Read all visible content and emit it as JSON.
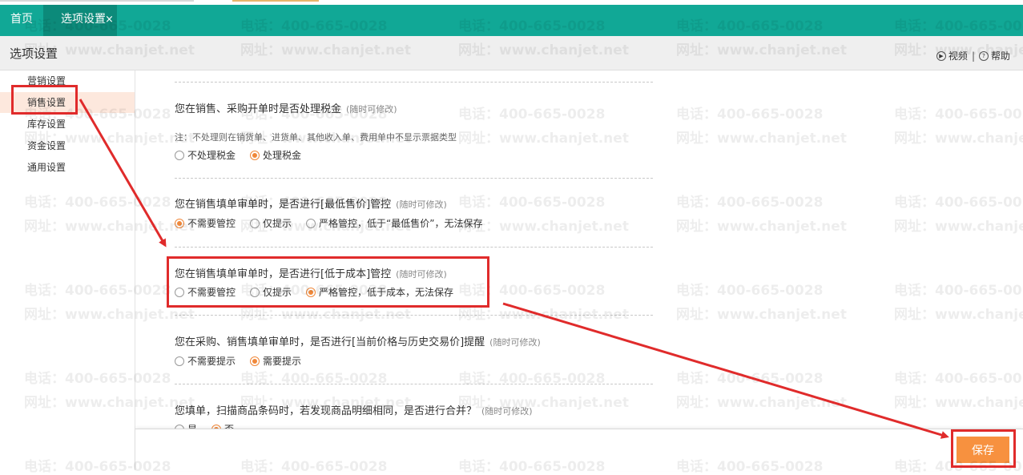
{
  "tabs": {
    "home": "首页",
    "active": "选项设置",
    "close": "×"
  },
  "header": {
    "title": "选项设置",
    "video": "视频",
    "help": "帮助",
    "divider": "|"
  },
  "sidebar": {
    "items": [
      {
        "label": "营销设置"
      },
      {
        "label": "销售设置",
        "active": true
      },
      {
        "label": "库存设置"
      },
      {
        "label": "资金设置"
      },
      {
        "label": "通用设置"
      }
    ]
  },
  "settings": [
    {
      "question": "您在销售、采购开单时是否处理税金",
      "hint": "(随时可修改)",
      "note": "注：不处理则在销货单、进货单、其他收入单、费用单中不显示票据类型",
      "options": [
        "不处理税金",
        "处理税金"
      ],
      "selected": 1
    },
    {
      "question": "您在销售填单审单时，是否进行[最低售价]管控",
      "hint": "(随时可修改)",
      "options": [
        "不需要管控",
        "仅提示",
        "严格管控，低于“最低售价”，无法保存"
      ],
      "selected": 0
    },
    {
      "question": "您在销售填单审单时，是否进行[低于成本]管控",
      "hint": "(随时可修改)",
      "options": [
        "不需要管控",
        "仅提示",
        "严格管控，低于成本，无法保存"
      ],
      "selected": 2
    },
    {
      "question": "您在采购、销售填单审单时，是否进行[当前价格与历史交易价]提醒",
      "hint": "(随时可修改)",
      "options": [
        "不需要提示",
        "需要提示"
      ],
      "selected": 1
    },
    {
      "question": "您填单，扫描商品条码时，若发现商品明细相同，是否进行合并？",
      "hint": "(随时可修改)",
      "options": [
        "是",
        "否"
      ],
      "selected": 1
    }
  ],
  "footer": {
    "save_label": "保存"
  },
  "watermark": {
    "phone": "电话：400-665-0028",
    "site": "网址：www.chanjet.net"
  },
  "colors": {
    "topbar": "#11a896",
    "accent": "#f7913f",
    "highlight": "#e02b2b"
  }
}
